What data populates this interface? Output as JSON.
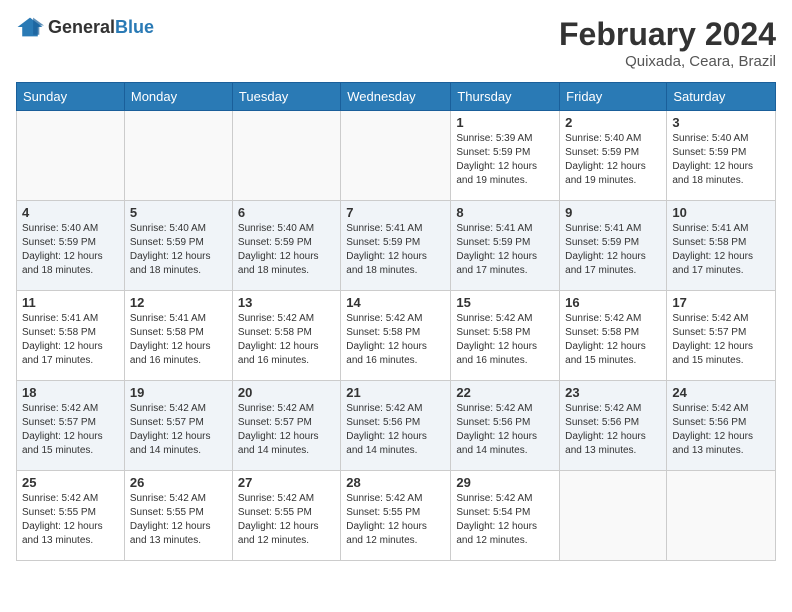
{
  "header": {
    "logo_general": "General",
    "logo_blue": "Blue",
    "month_year": "February 2024",
    "location": "Quixada, Ceara, Brazil"
  },
  "weekdays": [
    "Sunday",
    "Monday",
    "Tuesday",
    "Wednesday",
    "Thursday",
    "Friday",
    "Saturday"
  ],
  "weeks": [
    [
      {
        "day": "",
        "info": ""
      },
      {
        "day": "",
        "info": ""
      },
      {
        "day": "",
        "info": ""
      },
      {
        "day": "",
        "info": ""
      },
      {
        "day": "1",
        "info": "Sunrise: 5:39 AM\nSunset: 5:59 PM\nDaylight: 12 hours\nand 19 minutes."
      },
      {
        "day": "2",
        "info": "Sunrise: 5:40 AM\nSunset: 5:59 PM\nDaylight: 12 hours\nand 19 minutes."
      },
      {
        "day": "3",
        "info": "Sunrise: 5:40 AM\nSunset: 5:59 PM\nDaylight: 12 hours\nand 18 minutes."
      }
    ],
    [
      {
        "day": "4",
        "info": "Sunrise: 5:40 AM\nSunset: 5:59 PM\nDaylight: 12 hours\nand 18 minutes."
      },
      {
        "day": "5",
        "info": "Sunrise: 5:40 AM\nSunset: 5:59 PM\nDaylight: 12 hours\nand 18 minutes."
      },
      {
        "day": "6",
        "info": "Sunrise: 5:40 AM\nSunset: 5:59 PM\nDaylight: 12 hours\nand 18 minutes."
      },
      {
        "day": "7",
        "info": "Sunrise: 5:41 AM\nSunset: 5:59 PM\nDaylight: 12 hours\nand 18 minutes."
      },
      {
        "day": "8",
        "info": "Sunrise: 5:41 AM\nSunset: 5:59 PM\nDaylight: 12 hours\nand 17 minutes."
      },
      {
        "day": "9",
        "info": "Sunrise: 5:41 AM\nSunset: 5:59 PM\nDaylight: 12 hours\nand 17 minutes."
      },
      {
        "day": "10",
        "info": "Sunrise: 5:41 AM\nSunset: 5:58 PM\nDaylight: 12 hours\nand 17 minutes."
      }
    ],
    [
      {
        "day": "11",
        "info": "Sunrise: 5:41 AM\nSunset: 5:58 PM\nDaylight: 12 hours\nand 17 minutes."
      },
      {
        "day": "12",
        "info": "Sunrise: 5:41 AM\nSunset: 5:58 PM\nDaylight: 12 hours\nand 16 minutes."
      },
      {
        "day": "13",
        "info": "Sunrise: 5:42 AM\nSunset: 5:58 PM\nDaylight: 12 hours\nand 16 minutes."
      },
      {
        "day": "14",
        "info": "Sunrise: 5:42 AM\nSunset: 5:58 PM\nDaylight: 12 hours\nand 16 minutes."
      },
      {
        "day": "15",
        "info": "Sunrise: 5:42 AM\nSunset: 5:58 PM\nDaylight: 12 hours\nand 16 minutes."
      },
      {
        "day": "16",
        "info": "Sunrise: 5:42 AM\nSunset: 5:58 PM\nDaylight: 12 hours\nand 15 minutes."
      },
      {
        "day": "17",
        "info": "Sunrise: 5:42 AM\nSunset: 5:57 PM\nDaylight: 12 hours\nand 15 minutes."
      }
    ],
    [
      {
        "day": "18",
        "info": "Sunrise: 5:42 AM\nSunset: 5:57 PM\nDaylight: 12 hours\nand 15 minutes."
      },
      {
        "day": "19",
        "info": "Sunrise: 5:42 AM\nSunset: 5:57 PM\nDaylight: 12 hours\nand 14 minutes."
      },
      {
        "day": "20",
        "info": "Sunrise: 5:42 AM\nSunset: 5:57 PM\nDaylight: 12 hours\nand 14 minutes."
      },
      {
        "day": "21",
        "info": "Sunrise: 5:42 AM\nSunset: 5:56 PM\nDaylight: 12 hours\nand 14 minutes."
      },
      {
        "day": "22",
        "info": "Sunrise: 5:42 AM\nSunset: 5:56 PM\nDaylight: 12 hours\nand 14 minutes."
      },
      {
        "day": "23",
        "info": "Sunrise: 5:42 AM\nSunset: 5:56 PM\nDaylight: 12 hours\nand 13 minutes."
      },
      {
        "day": "24",
        "info": "Sunrise: 5:42 AM\nSunset: 5:56 PM\nDaylight: 12 hours\nand 13 minutes."
      }
    ],
    [
      {
        "day": "25",
        "info": "Sunrise: 5:42 AM\nSunset: 5:55 PM\nDaylight: 12 hours\nand 13 minutes."
      },
      {
        "day": "26",
        "info": "Sunrise: 5:42 AM\nSunset: 5:55 PM\nDaylight: 12 hours\nand 13 minutes."
      },
      {
        "day": "27",
        "info": "Sunrise: 5:42 AM\nSunset: 5:55 PM\nDaylight: 12 hours\nand 12 minutes."
      },
      {
        "day": "28",
        "info": "Sunrise: 5:42 AM\nSunset: 5:55 PM\nDaylight: 12 hours\nand 12 minutes."
      },
      {
        "day": "29",
        "info": "Sunrise: 5:42 AM\nSunset: 5:54 PM\nDaylight: 12 hours\nand 12 minutes."
      },
      {
        "day": "",
        "info": ""
      },
      {
        "day": "",
        "info": ""
      }
    ]
  ]
}
